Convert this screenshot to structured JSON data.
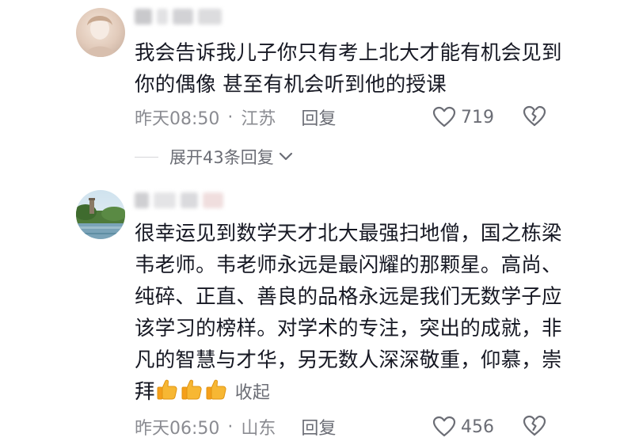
{
  "comments": [
    {
      "text": "我会告诉我儿子你只有考上北大才能有机会见到你的偶像 甚至有机会听到他的授课",
      "time": "昨天08:50",
      "location": "江苏",
      "reply_label": "回复",
      "likes": "719"
    },
    {
      "text": "很幸运见到数学天才北大最强扫地僧，国之栋梁韦老师。韦老师永远是最闪耀的那颗星。高尚、纯碎、正直、善良的品格永远是我们无数学子应该学习的榜样。对学术的专注，突出的成就，非凡的智慧与才华，另无数人深深敬重，仰慕，崇拜",
      "emoji": [
        "thumbs-up-icon",
        "thumbs-up-icon",
        "thumbs-up-icon"
      ],
      "collapse_label": "收起",
      "time": "昨天06:50",
      "location": "山东",
      "reply_label": "回复",
      "likes": "456"
    }
  ],
  "expand_replies": {
    "label": "展开43条回复"
  },
  "colors": {
    "text": "#161823",
    "meta": "#8a8b91",
    "action": "#6b6d75",
    "thumb": "#f7b733"
  }
}
